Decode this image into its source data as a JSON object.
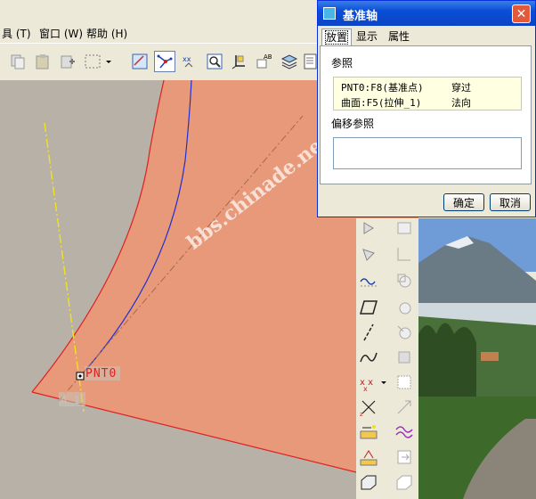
{
  "menu": {
    "items": [
      {
        "label": "具 (T)"
      },
      {
        "label": "窗口 (W)"
      },
      {
        "label": "帮助 (H)"
      }
    ]
  },
  "toolbar": {
    "icons": [
      "copy-icon",
      "paste-icon",
      "paste-special-icon",
      "select-box-icon",
      "dropdown-icon",
      "datum-plane-display-icon",
      "datum-axis-display-icon",
      "datum-point-display-icon",
      "zoom-window-icon",
      "csys-display-icon",
      "annotation-display-icon",
      "layers-icon",
      "model-tree-icon"
    ]
  },
  "graphics": {
    "point_label": "PNT0",
    "axis_tag": "A_1"
  },
  "watermark": "bbs.chinade.net",
  "dialog": {
    "title": "基准轴",
    "close_label": "✕",
    "tabs": [
      {
        "label": "放置"
      },
      {
        "label": "显示"
      },
      {
        "label": "属性"
      }
    ],
    "references_label": "参照",
    "references": [
      {
        "ref": "PNT0:F8(基准点)",
        "constraint": "穿过"
      },
      {
        "ref": "曲面:F5(拉伸_1)",
        "constraint": "法向"
      }
    ],
    "offset_label": "偏移参照",
    "ok_label": "确定",
    "cancel_label": "取消"
  },
  "colors": {
    "surface": "#e8997a",
    "surface_edge": "#e02020",
    "axis": "#f0e020",
    "curve": "#2030d0",
    "title_bar": "#0b4ed8"
  }
}
